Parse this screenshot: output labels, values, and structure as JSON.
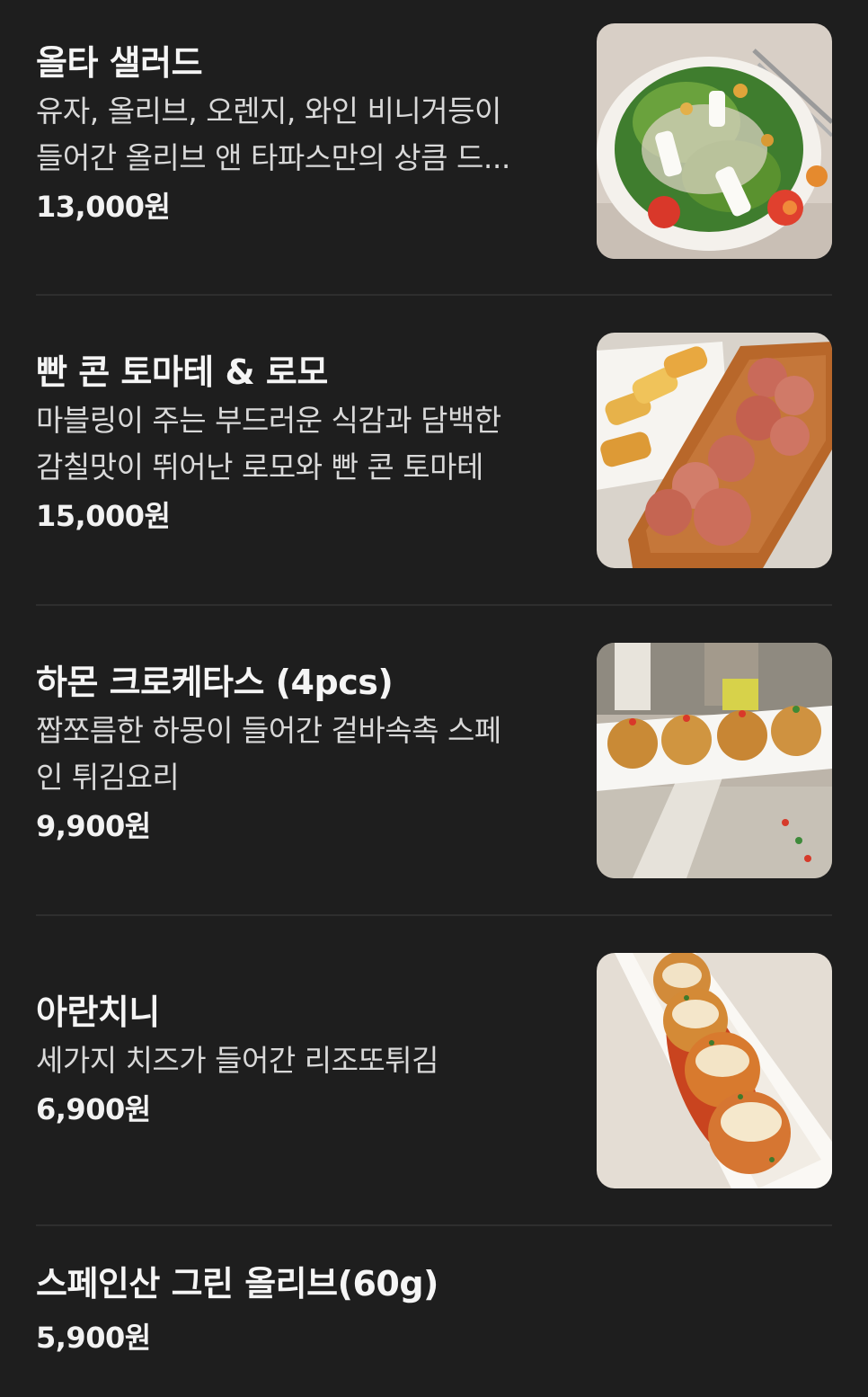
{
  "menu": {
    "items": [
      {
        "name": "올타 샐러드",
        "description_lines": [
          "유자, 올리브, 오렌지, 와인 비니거등이",
          "들어간 올리브 앤 타파스만의 상큼 드..."
        ],
        "price": "13,000원",
        "image": "salad-photo"
      },
      {
        "name": "빤 콘 토마테 & 로모",
        "description_lines": [
          "마블링이 주는 부드러운 식감과 담백한",
          "감칠맛이 뛰어난 로모와 빤 콘 토마테"
        ],
        "price": "15,000원",
        "image": "cured-meat-platter-photo"
      },
      {
        "name": "하몬 크로케타스 (4pcs)",
        "description_lines": [
          "짭쪼름한 하몽이 들어간 겉바속촉 스페",
          "인 튀김요리"
        ],
        "price": "9,900원",
        "image": "croquettes-photo"
      },
      {
        "name": "아란치니",
        "description_lines": [
          "세가지 치즈가 들어간 리조또튀김"
        ],
        "price": "6,900원",
        "image": "arancini-photo"
      },
      {
        "name": "스페인산 그린 올리브(60g)",
        "description_lines": [],
        "price": "5,900원",
        "image": ""
      }
    ]
  }
}
